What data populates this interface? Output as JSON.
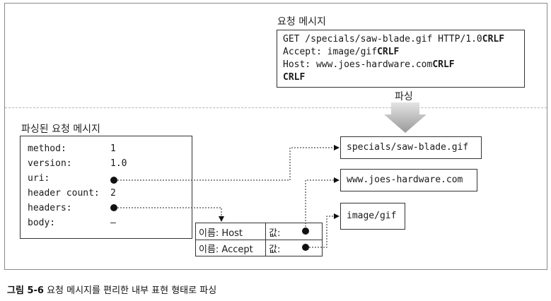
{
  "request": {
    "title": "요청 메시지",
    "lines": [
      {
        "text": "GET /specials/saw-blade.gif HTTP/1.0",
        "crlf": "CRLF"
      },
      {
        "text": "Accept: image/gif",
        "crlf": "CRLF"
      },
      {
        "text": "Host: www.joes-hardware.com",
        "crlf": "CRLF"
      },
      {
        "text": "",
        "crlf": "CRLF"
      }
    ]
  },
  "parse_label": "파싱",
  "parsed": {
    "title": "파싱된 요청 메시지",
    "rows": [
      {
        "key": "method:",
        "value": "1"
      },
      {
        "key": "version:",
        "value": "1.0"
      },
      {
        "key": "uri:",
        "value": ""
      },
      {
        "key": "header count:",
        "value": "2"
      },
      {
        "key": "headers:",
        "value": ""
      },
      {
        "key": "body:",
        "value": "–"
      }
    ]
  },
  "targets": {
    "uri": "specials/saw-blade.gif",
    "host": "www.joes-hardware.com",
    "accept": "image/gif"
  },
  "headers_table": {
    "rows": [
      {
        "name": "이름: Host",
        "value": "값:"
      },
      {
        "name": "이름: Accept",
        "value": "값:"
      }
    ]
  },
  "caption": {
    "label": "그림 5-6",
    "text": "요청 메시지를 편리한 내부 표현 형태로 파싱"
  }
}
